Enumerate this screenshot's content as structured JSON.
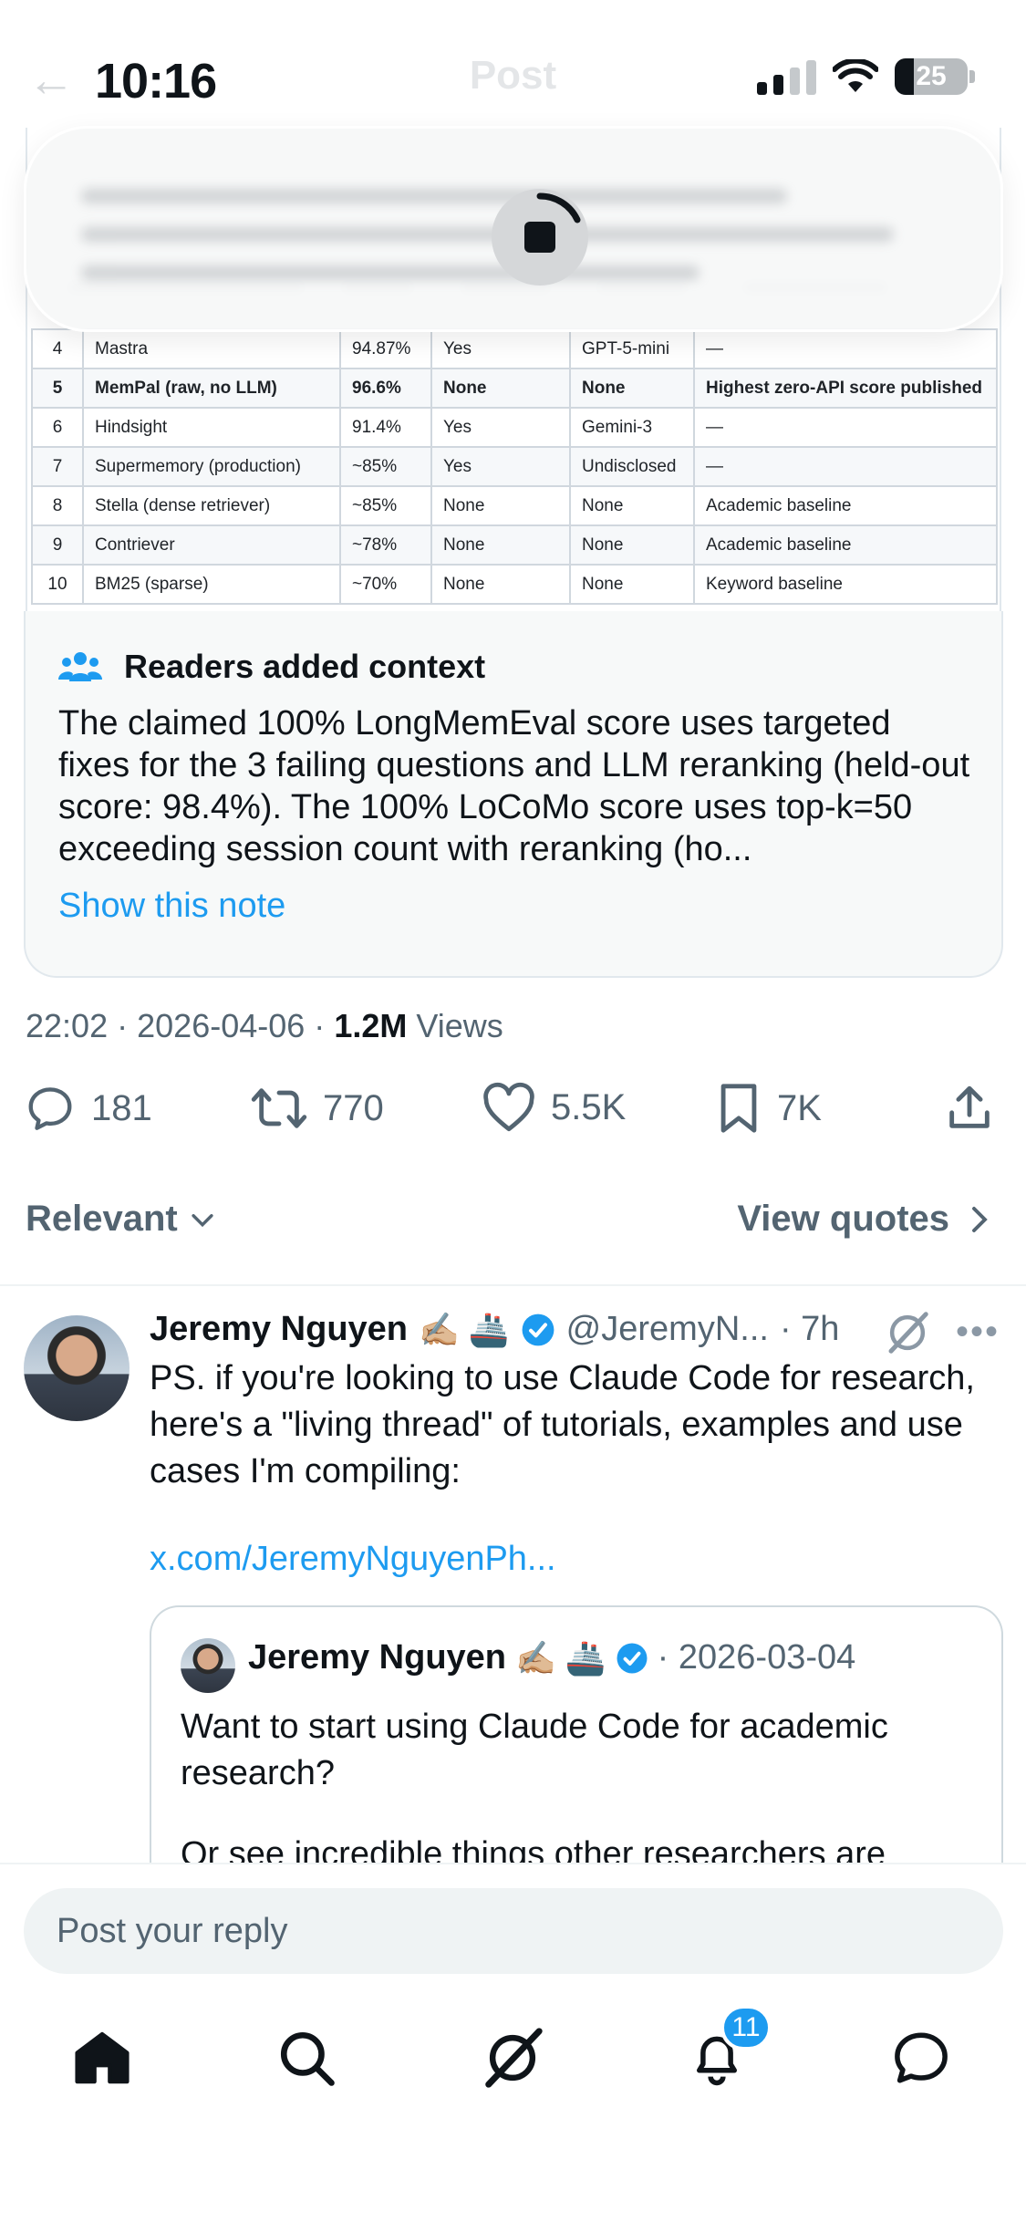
{
  "status_bar": {
    "time": "10:16",
    "battery": "25"
  },
  "header": {
    "title": "Post"
  },
  "table": {
    "rows": [
      {
        "rank": "4",
        "system": "Mastra",
        "score": "94.87%",
        "llm": "Yes",
        "model": "GPT-5-mini",
        "notes": "—",
        "bold": false
      },
      {
        "rank": "5",
        "system": "MemPal (raw, no LLM)",
        "score": "96.6%",
        "llm": "None",
        "model": "None",
        "notes": "Highest zero-API score published",
        "bold": true
      },
      {
        "rank": "6",
        "system": "Hindsight",
        "score": "91.4%",
        "llm": "Yes",
        "model": "Gemini-3",
        "notes": "—",
        "bold": false
      },
      {
        "rank": "7",
        "system": "Supermemory (production)",
        "score": "~85%",
        "llm": "Yes",
        "model": "Undisclosed",
        "notes": "—",
        "bold": false
      },
      {
        "rank": "8",
        "system": "Stella (dense retriever)",
        "score": "~85%",
        "llm": "None",
        "model": "None",
        "notes": "Academic baseline",
        "bold": false
      },
      {
        "rank": "9",
        "system": "Contriever",
        "score": "~78%",
        "llm": "None",
        "model": "None",
        "notes": "Academic baseline",
        "bold": false
      },
      {
        "rank": "10",
        "system": "BM25 (sparse)",
        "score": "~70%",
        "llm": "None",
        "model": "None",
        "notes": "Keyword baseline",
        "bold": false
      }
    ]
  },
  "note": {
    "title": "Readers added context",
    "body": "The claimed 100% LongMemEval score uses targeted fixes for the 3 failing questions and LLM reranking (held-out score: 98.4%). The 100% LoCoMo score uses top-k=50 exceeding session count with reranking (ho...",
    "link": "Show this note"
  },
  "meta": {
    "time": "22:02",
    "date": "2026-04-06",
    "views_count": "1.2M",
    "views_label": "Views",
    "sep": "·"
  },
  "actions": {
    "replies": "181",
    "reposts": "770",
    "likes": "5.5K",
    "bookmarks": "7K"
  },
  "sort": {
    "label": "Relevant",
    "quotes": "View quotes"
  },
  "reply": {
    "name": "Jeremy Nguyen",
    "emoji": "✍🏼 🚢",
    "handle": "@JeremyN...",
    "age": "· 7h",
    "text": "PS. if you're looking to use Claude Code for research, here's a \"living thread\" of tutorials, examples and use cases I'm compiling:",
    "link": "x.com/JeremyNguyenPh..."
  },
  "quote": {
    "name": "Jeremy Nguyen",
    "emoji": "✍🏼 🚢",
    "date": "· 2026-03-04",
    "text": "Want to start using Claude Code for academic research?",
    "cut_text": "Or see incredible things other researchers are"
  },
  "composer": {
    "placeholder": "Post your reply"
  },
  "tabs": {
    "notifications_badge": "11"
  },
  "colors": {
    "accent": "#1d9bf0",
    "secondary_text": "#536471",
    "primary_text": "#0f1419"
  }
}
